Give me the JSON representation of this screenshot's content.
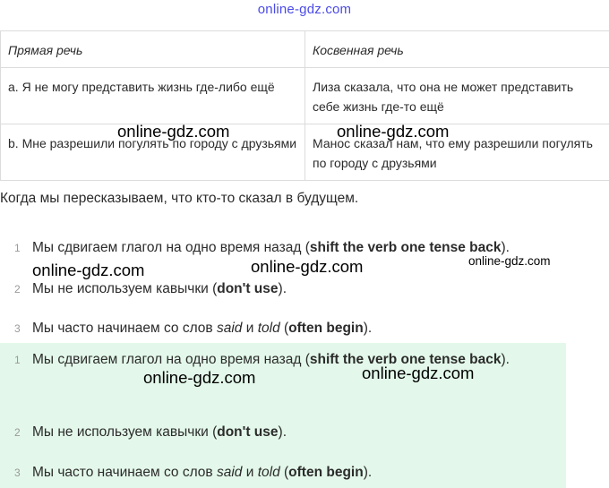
{
  "site_logo": "online-gdz.com",
  "table": {
    "headers": [
      "Прямая речь",
      "Косвенная речь"
    ],
    "rows": [
      [
        "a. Я не могу представить жизнь где-либо ещё",
        "Лиза сказала, что она не может представить себе жизнь где-то ещё"
      ],
      [
        "b. Мне разрешили погулять по городу с друзьями",
        "Манос сказал нам, что ему разрешили погулять по городу с друзьями"
      ]
    ]
  },
  "intro": "Когда мы пересказываем, что кто-то сказал в будущем.",
  "rules_plain": [
    {
      "num": "1",
      "pre": "Мы сдвигаем глагол на одно время назад (",
      "bold": "shift the verb one tense back",
      "post": ")."
    },
    {
      "num": "2",
      "pre": "Мы не используем кавычки (",
      "bold": "don't use",
      "post": ")."
    },
    {
      "num": "3",
      "pre": "Мы часто начинаем со слов ",
      "it1": "said",
      "mid": " и ",
      "it2": "told",
      "pre2": " (",
      "bold": "often begin",
      "post": ")."
    }
  ],
  "rules_highlight": [
    {
      "num": "1",
      "pre": "Мы сдвигаем глагол на одно время назад (",
      "bold": "shift the verb one tense back",
      "post": ")."
    },
    {
      "num": "2",
      "pre": "Мы не используем кавычки (",
      "bold": "don't use",
      "post": ")."
    },
    {
      "num": "3",
      "pre": "Мы часто начинаем со слов ",
      "it1": "said",
      "mid": " и ",
      "it2": "told",
      "pre2": " (",
      "bold": "often begin",
      "post": ")."
    }
  ],
  "watermarks": [
    "online-gdz.com",
    "online-gdz.com",
    "online-gdz.com",
    "online-gdz.com",
    "online-gdz.com",
    "online-gdz.com",
    "online-gdz.com"
  ]
}
